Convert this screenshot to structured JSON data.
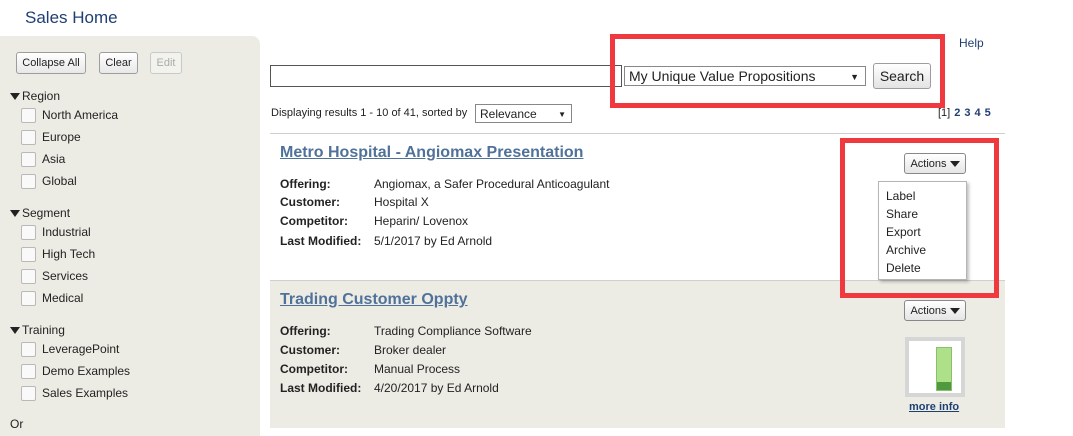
{
  "app": {
    "title": "Sales Home"
  },
  "header": {
    "help": "Help"
  },
  "sidebar": {
    "buttons": {
      "collapse_all": "Collapse All",
      "clear": "Clear",
      "edit": "Edit"
    },
    "groups": [
      {
        "label": "Region",
        "items": [
          "North America",
          "Europe",
          "Asia",
          "Global"
        ]
      },
      {
        "label": "Segment",
        "items": [
          "Industrial",
          "High Tech",
          "Services",
          "Medical"
        ]
      },
      {
        "label": "Training",
        "items": [
          "LeveragePoint",
          "Demo Examples",
          "Sales Examples"
        ]
      }
    ],
    "or_label": "Or"
  },
  "search": {
    "query": "",
    "scope": "My Unique Value Propositions",
    "button": "Search"
  },
  "results": {
    "info": "Displaying results 1 - 10 of 41, sorted by",
    "sort": "Relevance",
    "pages": [
      "[1]",
      "2",
      "3",
      "4",
      "5"
    ]
  },
  "cards": [
    {
      "title": "Metro Hospital - Angiomax Presentation",
      "fields": [
        {
          "key": "Offering:",
          "value": "Angiomax, a Safer Procedural Anticoagulant"
        },
        {
          "key": "Customer:",
          "value": "Hospital X"
        },
        {
          "key": "Competitor:",
          "value": "Heparin/ Lovenox"
        },
        {
          "key": "Last Modified:",
          "value": "5/1/2017 by Ed Arnold"
        }
      ],
      "actions": "Actions"
    },
    {
      "title": "Trading Customer Oppty",
      "fields": [
        {
          "key": "Offering:",
          "value": "Trading Compliance Software"
        },
        {
          "key": "Customer:",
          "value": "Broker dealer"
        },
        {
          "key": "Competitor:",
          "value": "Manual Process"
        },
        {
          "key": "Last Modified:",
          "value": "4/20/2017 by Ed Arnold"
        }
      ],
      "actions": "Actions",
      "more_info": "more info"
    }
  ],
  "actions_menu": [
    "Label",
    "Share",
    "Export",
    "Archive",
    "Delete"
  ],
  "colors": {
    "highlight": "#f0393f",
    "link": "#1f3f73",
    "title_link": "#50719a",
    "sidebar_bg": "#edece4"
  }
}
